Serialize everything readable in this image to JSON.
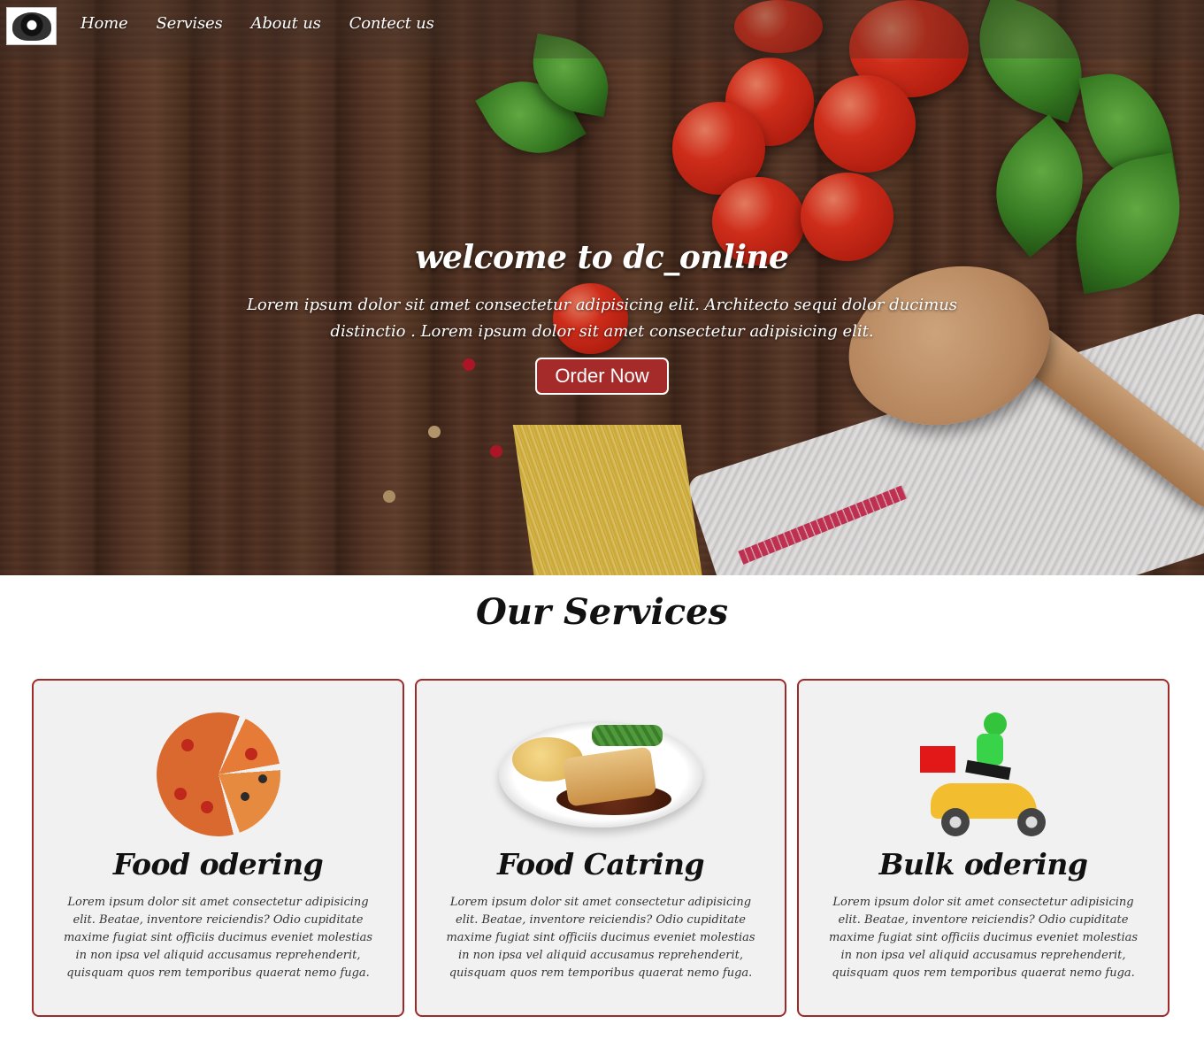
{
  "nav": {
    "logo_alt": "dc_online logo",
    "links": [
      "Home",
      "Servises",
      "About us",
      "Contect us"
    ]
  },
  "hero": {
    "title": "welcome to dc_online",
    "text": "Lorem ipsum dolor sit amet consectetur adipisicing elit. Architecto sequi dolor ducimus distinctio . Lorem ipsum dolor sit amet consectetur adipisicing elit.",
    "button_label": "Order Now"
  },
  "services": {
    "title": "Our Services",
    "cards": [
      {
        "title": "Food odering",
        "icon": "pizza-icon",
        "text": "Lorem ipsum dolor sit amet consectetur adipisicing elit. Beatae, inventore reiciendis? Odio cupiditate maxime fugiat sint officiis ducimus eveniet molestias in non ipsa vel aliquid accusamus reprehenderit, quisquam quos rem temporibus quaerat nemo fuga."
      },
      {
        "title": "Food Catring",
        "icon": "plate-icon",
        "text": "Lorem ipsum dolor sit amet consectetur adipisicing elit. Beatae, inventore reiciendis? Odio cupiditate maxime fugiat sint officiis ducimus eveniet molestias in non ipsa vel aliquid accusamus reprehenderit, quisquam quos rem temporibus quaerat nemo fuga."
      },
      {
        "title": "Bulk odering",
        "icon": "delivery-scooter-icon",
        "text": "Lorem ipsum dolor sit amet consectetur adipisicing elit. Beatae, inventore reiciendis? Odio cupiditate maxime fugiat sint officiis ducimus eveniet molestias in non ipsa vel aliquid accusamus reprehenderit, quisquam quos rem temporibus quaerat nemo fuga."
      }
    ]
  },
  "colors": {
    "accent": "#a52a2a",
    "card_border": "#9e2a2a",
    "card_bg": "#f1f1f1"
  }
}
